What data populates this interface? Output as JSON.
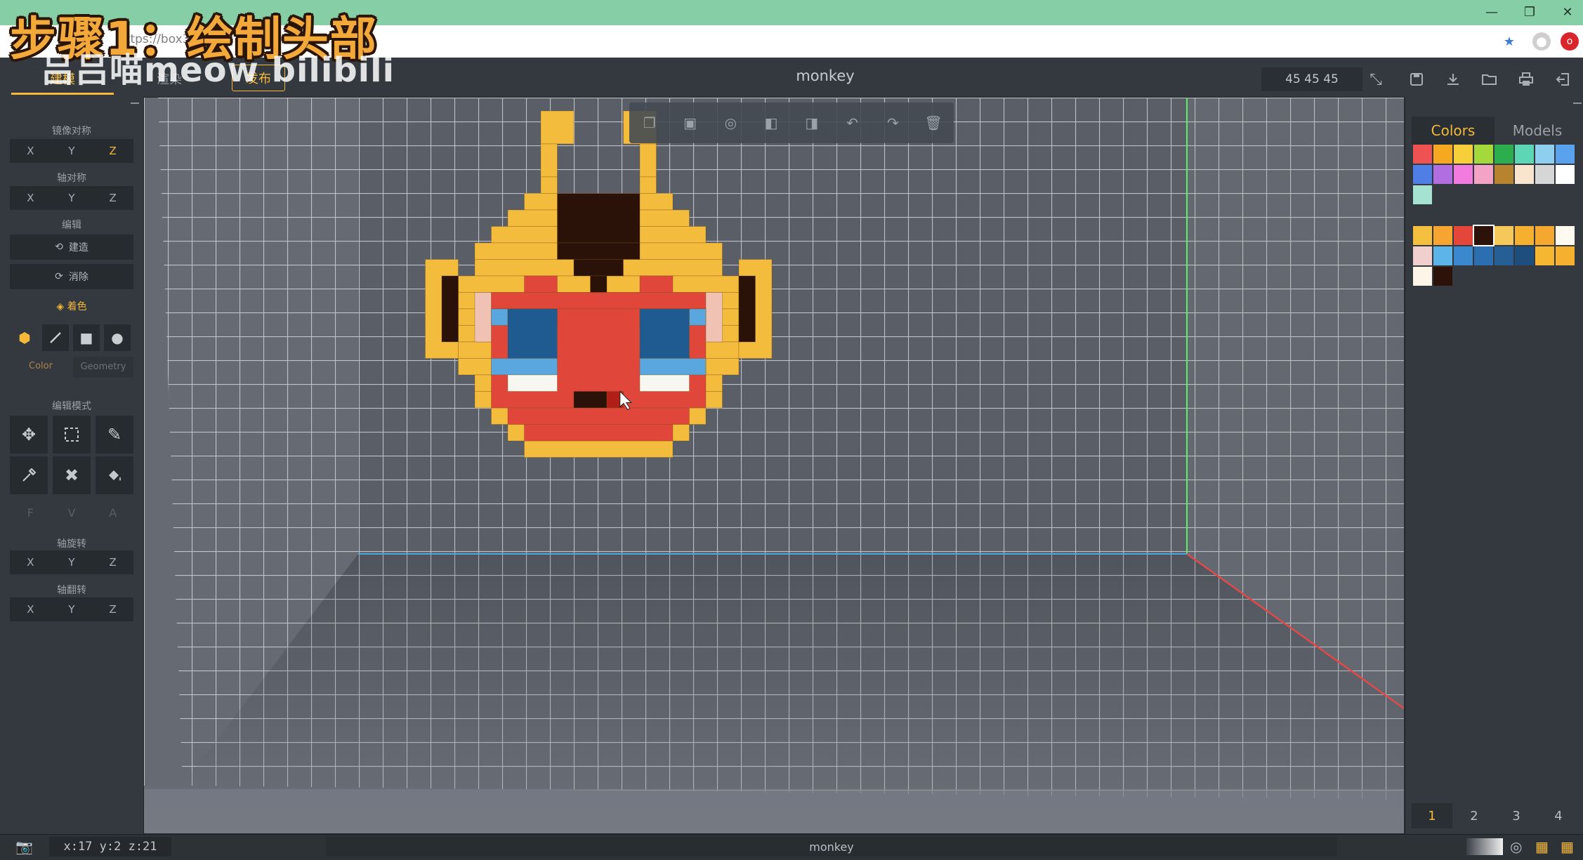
{
  "overlay": {
    "step_title": "步骤1：绘制头部",
    "watermark": "吕吕喵meow bilibili"
  },
  "browser": {
    "url": "https://box3.",
    "window_controls": [
      "—",
      "❐",
      "✕"
    ]
  },
  "header": {
    "tabs": [
      "建模",
      "渲染",
      "发布"
    ],
    "title": "monkey",
    "dimensions": "45 45 45",
    "icons": [
      "compress-icon",
      "save-icon",
      "download-icon",
      "open-folder-icon",
      "print-icon",
      "exit-icon"
    ]
  },
  "left_panel": {
    "mirror_label": "镜像对称",
    "axis_label": "轴对称",
    "edit_label": "编辑",
    "build_label": "建造",
    "erase_label": "消除",
    "paint_label": "着色",
    "color_label": "Color",
    "geometry_label": "Geometry",
    "mode_label": "编辑模式",
    "rotate_label": "轴旋转",
    "flip_label": "轴翻转",
    "fva": [
      "F",
      "V",
      "A"
    ],
    "axes": [
      "X",
      "Y",
      "Z"
    ],
    "active_mirror_axis": "Z"
  },
  "right_panel": {
    "tabs": [
      "Colors",
      "Models"
    ],
    "active_tab": "Colors",
    "palette_default": [
      "#ee5252",
      "#f5a820",
      "#f6cf3a",
      "#a3d93a",
      "#2dae4e",
      "#5cd6b4",
      "#8ecff0",
      "#5aa2ee",
      "#4f7fe6",
      "#b06ee0",
      "#f27be0",
      "#f3a3c3",
      "#b8832f",
      "#f9e5cd",
      "#d6d6d6",
      "#ffffff",
      "#a6e2d2"
    ],
    "palette_custom": [
      "#f5c040",
      "#f5a530",
      "#e4463a",
      "#2c1208",
      "#f5c85a",
      "#f5b030",
      "#f5a830",
      "#fefaf0",
      "#f1cfcf",
      "#5cb4e8",
      "#3b88cf",
      "#2c6fb0",
      "#265e96",
      "#1e4e7e",
      "#f5b732",
      "#f5b030",
      "#fdf5e8",
      "#2c1208"
    ],
    "pages": [
      "1",
      "2",
      "3",
      "4"
    ],
    "active_page": "1"
  },
  "status": {
    "coords": "x:17 y:2 z:21",
    "name": "monkey"
  }
}
